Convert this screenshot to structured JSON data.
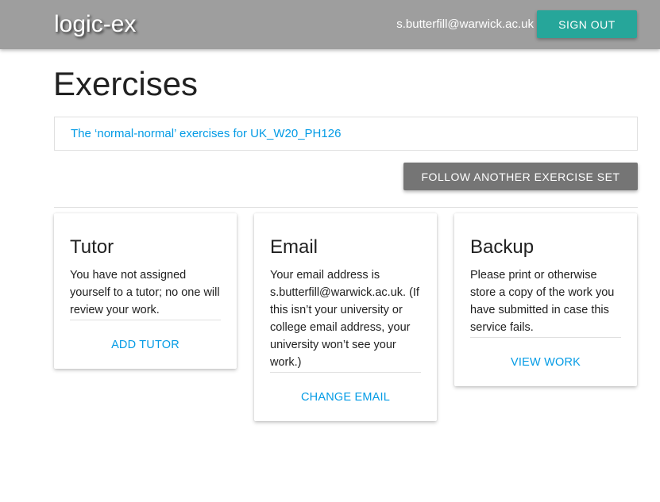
{
  "header": {
    "brand": "logic-ex",
    "user_email": "s.butterfill@warwick.ac.uk",
    "sign_out_label": "SIGN OUT"
  },
  "main": {
    "title": "Exercises",
    "exercise_sets": [
      {
        "label": "The ‘normal-normal’ exercises for UK_W20_PH126"
      }
    ],
    "follow_button_label": "FOLLOW ANOTHER EXERCISE SET"
  },
  "cards": {
    "tutor": {
      "title": "Tutor",
      "text": "You have not assigned yourself to a tutor; no one will review your work.",
      "action_label": "ADD TUTOR"
    },
    "email": {
      "title": "Email",
      "text": "Your email address is s.butterfill@warwick.ac.uk. (If this isn’t your university or college email address, your university won’t see your work.)",
      "action_label": "CHANGE EMAIL"
    },
    "backup": {
      "title": "Backup",
      "text": "Please print or otherwise store a copy of the work you have submitted in case this service fails.",
      "action_label": "VIEW WORK"
    }
  },
  "colors": {
    "header_bg": "#9e9e9e",
    "sign_out_bg": "#26a69a",
    "follow_bg": "#757575",
    "link": "#039be5"
  }
}
